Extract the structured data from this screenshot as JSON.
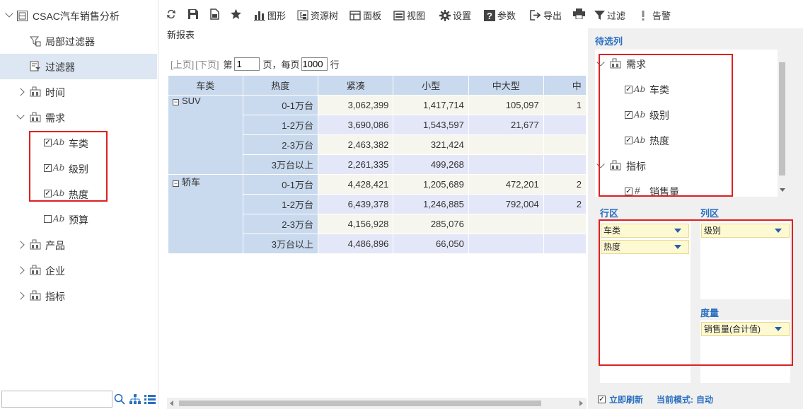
{
  "left_tree": {
    "root": "CSAC汽车销售分析",
    "local_filter": "局部过滤器",
    "filter": "过滤器",
    "time": "时间",
    "demand": "需求",
    "demand_items": [
      {
        "label": "车类",
        "checked": true
      },
      {
        "label": "级别",
        "checked": true
      },
      {
        "label": "热度",
        "checked": true
      },
      {
        "label": "预算",
        "checked": false
      }
    ],
    "product": "产品",
    "enterprise": "企业",
    "indicator": "指标",
    "ab_glyph": "Ab",
    "search_placeholder": ""
  },
  "toolbar": {
    "chart": "图形",
    "resource_tree": "资源树",
    "panel": "面板",
    "view": "视图",
    "settings": "设置",
    "params": "参数",
    "export": "导出",
    "filter": "过滤",
    "alert": "告警"
  },
  "report": {
    "title": "新报表",
    "pager": {
      "prev": "[上页]",
      "next": "[下页]",
      "page_prefix": "第",
      "page_value": "1",
      "page_suffix": "页，每页",
      "size_value": "1000",
      "size_suffix": "行"
    },
    "headers": [
      "车类",
      "热度",
      "紧凑",
      "小型",
      "中大型",
      "中"
    ],
    "groups": [
      {
        "name": "SUV",
        "rows": [
          {
            "heat": "0-1万台",
            "vals": [
              "3,062,399",
              "1,417,714",
              "105,097",
              "1"
            ]
          },
          {
            "heat": "1-2万台",
            "vals": [
              "3,690,086",
              "1,543,597",
              "21,677",
              ""
            ]
          },
          {
            "heat": "2-3万台",
            "vals": [
              "2,463,382",
              "321,424",
              "",
              ""
            ]
          },
          {
            "heat": "3万台以上",
            "vals": [
              "2,261,335",
              "499,268",
              "",
              ""
            ]
          }
        ]
      },
      {
        "name": "轿车",
        "rows": [
          {
            "heat": "0-1万台",
            "vals": [
              "4,428,421",
              "1,205,689",
              "472,201",
              "2"
            ]
          },
          {
            "heat": "1-2万台",
            "vals": [
              "6,439,378",
              "1,246,885",
              "792,004",
              "2"
            ]
          },
          {
            "heat": "2-3万台",
            "vals": [
              "4,156,928",
              "285,076",
              "",
              ""
            ]
          },
          {
            "heat": "3万台以上",
            "vals": [
              "4,486,896",
              "66,050",
              "",
              ""
            ]
          }
        ]
      }
    ]
  },
  "right_panel": {
    "candidates_title": "待选列",
    "demand": "需求",
    "demand_items": [
      "车类",
      "级别",
      "热度"
    ],
    "indicator": "指标",
    "indicator_items": [
      "销售量"
    ],
    "hash_glyph": "#",
    "row_area": "行区",
    "col_area": "列区",
    "measure": "度量",
    "row_chips": [
      "车类",
      "热度"
    ],
    "col_chips": [
      "级别"
    ],
    "measure_chips": [
      "销售量(合计值)"
    ],
    "refresh_label": "立即刷新",
    "refresh_checked": true,
    "mode_label": "当前模式:",
    "mode_value": "自动"
  }
}
